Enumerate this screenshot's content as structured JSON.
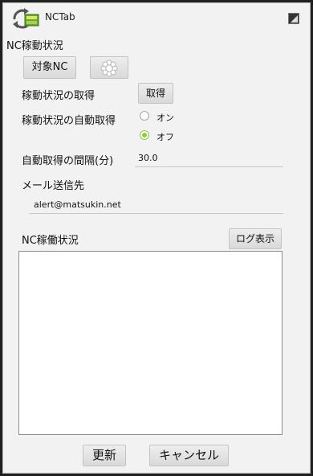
{
  "window": {
    "title": "NCTab"
  },
  "status_section": {
    "heading": "NC稼動状況",
    "target_nc_label": "対象NC",
    "fetch_status_label": "稼動状況の取得",
    "fetch_button_label": "取得",
    "auto_fetch_label": "稼動状況の自動取得",
    "auto_fetch_options": [
      {
        "label": "オン",
        "selected": false
      },
      {
        "label": "オフ",
        "selected": true
      }
    ],
    "interval_label": "自動取得の間隔(分)",
    "interval_value": "30.0"
  },
  "mail_section": {
    "heading": "メール送信先",
    "email_value": "alert@matsukin.net"
  },
  "log_section": {
    "heading": "NC稼働状況",
    "show_log_label": "ログ表示",
    "log_text": ""
  },
  "footer": {
    "update_label": "更新",
    "cancel_label": "キャンセル"
  }
}
